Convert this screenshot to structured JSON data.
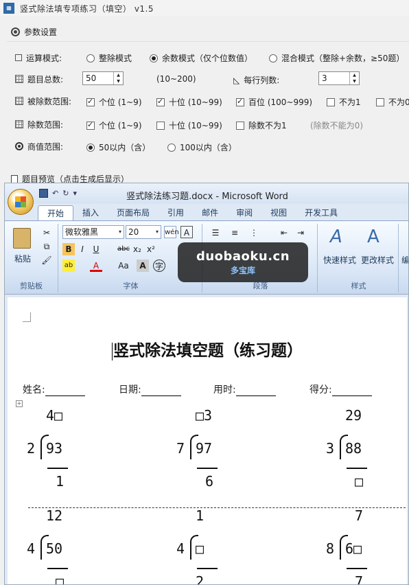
{
  "app": {
    "icon": "app-grid-icon",
    "title": "竖式除法填专项练习（填空） v1.5"
  },
  "params": {
    "header": "参数设置",
    "op_mode": {
      "label": "运算模式:",
      "options": [
        "整除模式",
        "余数模式（仅个位数值）",
        "混合模式（整除+余数，≥50题）"
      ],
      "selected": 1
    },
    "total": {
      "label": "题目总数:",
      "value": "50",
      "hint": "(10~200)"
    },
    "per_row": {
      "label": "每行列数:",
      "value": "3"
    },
    "dividend_range": {
      "label": "被除数范围:",
      "options": [
        {
          "text": "个位 (1~9)",
          "checked": true
        },
        {
          "text": "十位 (10~99)",
          "checked": true
        },
        {
          "text": "百位 (100~999)",
          "checked": true
        },
        {
          "text": "不为1",
          "checked": false
        },
        {
          "text": "不为0",
          "checked": false
        }
      ]
    },
    "divisor_range": {
      "label": "除数范围:",
      "options": [
        {
          "text": "个位 (1~9)",
          "checked": true
        },
        {
          "text": "十位 (10~99)",
          "checked": false
        },
        {
          "text": "除数不为1",
          "checked": false
        }
      ],
      "hint": "(除数不能为0)"
    },
    "quotient_range": {
      "label": "商值范围:",
      "options": [
        "50以内（含）",
        "100以内（含）"
      ],
      "selected": 0
    }
  },
  "preview": {
    "header": "题目预览（点击生成后显示）"
  },
  "word": {
    "title": "竖式除法练习题.docx - Microsoft Word",
    "tabs": [
      "开始",
      "插入",
      "页面布局",
      "引用",
      "邮件",
      "审阅",
      "视图",
      "开发工具"
    ],
    "active_tab": 0,
    "font_name": "微软雅黑",
    "font_size": "20",
    "paste_label": "粘贴",
    "groups": {
      "clipboard": "剪贴板",
      "font": "字体",
      "paragraph": "段落",
      "styles": "样式"
    },
    "quick_style": "快速样式",
    "change_style": "更改样式",
    "edit_label": "编"
  },
  "watermark": {
    "line1": "duobaoku.cn",
    "line2": "多宝库"
  },
  "document": {
    "title": "竖式除法填空题（练习题）",
    "fields": [
      {
        "label": "姓名:"
      },
      {
        "label": "日期:"
      },
      {
        "label": "用时:"
      },
      {
        "label": "得分:"
      }
    ],
    "problems": [
      {
        "quotient": "4□",
        "divisor": "2",
        "dividend": "93",
        "remainder": "1"
      },
      {
        "quotient": "□3",
        "divisor": "7",
        "dividend": "97",
        "remainder": "6"
      },
      {
        "quotient": "29",
        "divisor": "3",
        "dividend": "88",
        "remainder": "□"
      },
      {
        "quotient": "12",
        "divisor": "4",
        "dividend": "50",
        "remainder": "□"
      },
      {
        "quotient": "1",
        "divisor": "4",
        "dividend": "□",
        "remainder": "2"
      },
      {
        "quotient": "7",
        "divisor": "8",
        "dividend": "6□",
        "remainder": "7"
      }
    ]
  }
}
